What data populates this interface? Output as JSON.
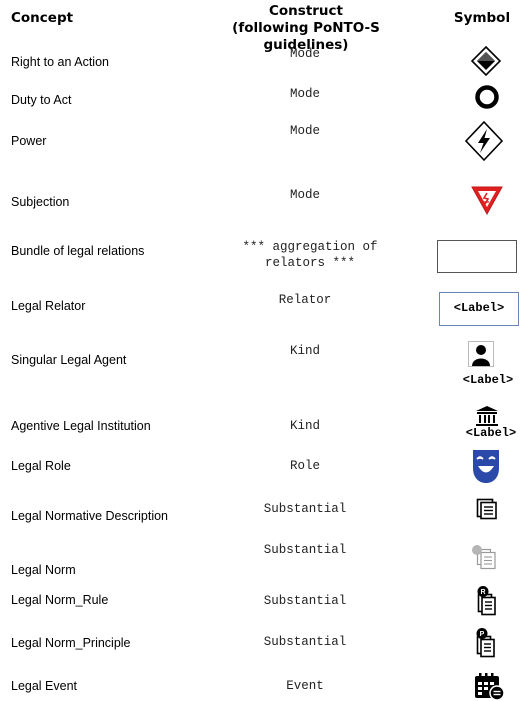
{
  "header": {
    "concept": "Concept",
    "construct_line1": "Construct",
    "construct_line2": "(following PoNTO-S guidelines)",
    "symbol": "Symbol"
  },
  "rows": [
    {
      "concept": "Right to an Action",
      "construct": "Mode",
      "icon": "diamond-icon"
    },
    {
      "concept": "Duty to Act",
      "construct": "Mode",
      "icon": "ring-icon"
    },
    {
      "concept": "Power",
      "construct": "Mode",
      "icon": "lightning-diamond-icon"
    },
    {
      "concept": "Subjection",
      "construct": "Mode",
      "icon": "warning-triangle-icon"
    },
    {
      "concept": "Bundle of legal relations",
      "construct": "*** aggregation of relators ***",
      "icon": "empty-box-icon"
    },
    {
      "concept": "Legal Relator",
      "construct": "Relator",
      "icon": "label-box-icon",
      "label": "<Label>"
    },
    {
      "concept": "Singular Legal Agent",
      "construct": "Kind",
      "icon": "person-icon",
      "label": "<Label>"
    },
    {
      "concept": "Agentive Legal Institution",
      "construct": "Kind",
      "icon": "institution-icon",
      "label": "<Label>"
    },
    {
      "concept": "Legal Role",
      "construct": "Role",
      "icon": "mask-icon"
    },
    {
      "concept": "Legal Normative Description",
      "construct": "Substantial",
      "icon": "document-stack-icon"
    },
    {
      "concept": "Legal Norm",
      "construct": "Substantial",
      "icon": "norm-document-icon"
    },
    {
      "concept": "Legal Norm_Rule",
      "construct": "Substantial",
      "icon": "rule-document-icon",
      "badge": "R"
    },
    {
      "concept": "Legal Norm_Principle",
      "construct": "Substantial",
      "icon": "principle-document-icon",
      "badge": "P"
    },
    {
      "concept": "Legal Event",
      "construct": "Event",
      "icon": "calendar-event-icon"
    }
  ],
  "colors": {
    "text": "#000000",
    "subjection_red": "#e02020",
    "mask_blue": "#2b49a8",
    "label_box_border": "#6a86b3",
    "faded_norm": "#9a9a9a"
  }
}
